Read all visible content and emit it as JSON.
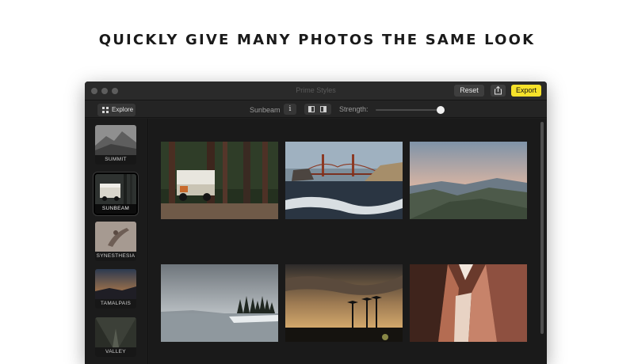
{
  "headline": "QUICKLY GIVE MANY PHOTOS THE SAME LOOK",
  "window": {
    "title": "Prime Styles",
    "buttons": {
      "reset": "Reset",
      "export": "Export"
    }
  },
  "toolbar": {
    "explore_label": "Explore",
    "style_name": "Sunbeam",
    "info_label": "i",
    "strength_label": "Strength:",
    "strength_value": 0.97
  },
  "sidebar": {
    "styles": [
      {
        "label": "SUMMIT",
        "active": false
      },
      {
        "label": "SUNBEAM",
        "active": true
      },
      {
        "label": "SYNESTHESIA",
        "active": false
      },
      {
        "label": "TAMALPAIS",
        "active": false
      },
      {
        "label": "VALLEY",
        "active": false
      }
    ]
  },
  "photos": [
    {
      "name": "photo-camper-van-forest"
    },
    {
      "name": "photo-golden-gate-beach"
    },
    {
      "name": "photo-mountain-ridge-dusk"
    },
    {
      "name": "photo-lake-winter-trees"
    },
    {
      "name": "photo-palm-trees-sunset"
    },
    {
      "name": "photo-red-rock-canyon"
    }
  ],
  "colors": {
    "export_accent": "#f7e22a",
    "window_bg": "#1e1e1e",
    "titlebar_bg": "#2a2a2a"
  }
}
